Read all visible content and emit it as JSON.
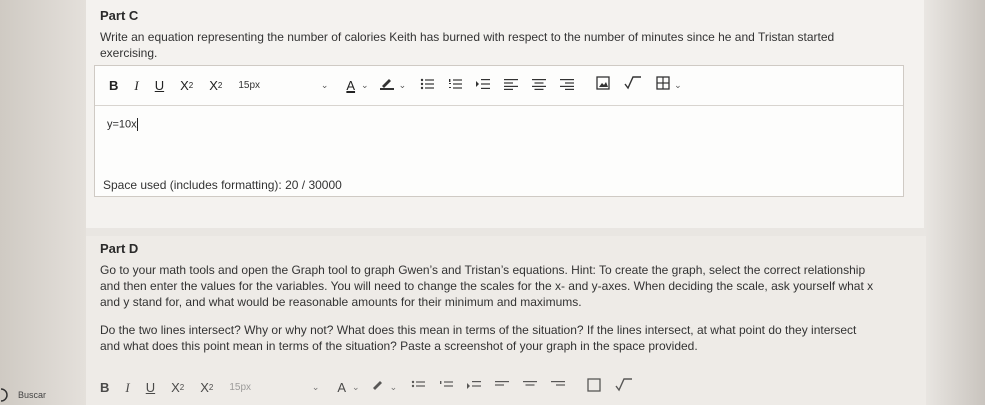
{
  "partC": {
    "title": "Part C",
    "prompt_line1": "Write an equation representing the number of calories Keith has burned with respect to the number of minutes since he and Tristan started",
    "prompt_line2": "exercising.",
    "editor": {
      "toolbar": {
        "bold": "B",
        "italic": "I",
        "underline": "U",
        "superscript_base": "X",
        "superscript_mark": "2",
        "subscript_base": "X",
        "subscript_mark": "2",
        "font_size": "15px",
        "font_color_label": "A"
      },
      "content": "y=10x",
      "space_used": "Space used (includes formatting): 20 / 30000"
    }
  },
  "partD": {
    "title": "Part D",
    "para1_line1": "Go to your math tools and open the Graph tool to graph Gwen’s and Tristan’s equations. Hint: To create the graph, select the correct relationship",
    "para1_line2": "and then enter the values for the variables. You will need to change the scales for the x- and y-axes. When deciding the scale, ask yourself what x",
    "para1_line3": "and y stand for, and what would be reasonable amounts for their minimum and maximums.",
    "para2_line1": "Do the two lines intersect? Why or why not? What does this mean in terms of the situation? If the lines intersect, at what point do they intersect",
    "para2_line2": "and what does this point mean in terms of the situation? Paste a screenshot of your graph in the space provided.",
    "editor": {
      "toolbar": {
        "bold": "B",
        "italic": "I",
        "underline": "U",
        "superscript_base": "X",
        "superscript_mark": "2",
        "subscript_base": "X",
        "subscript_mark": "2",
        "font_size": "15px",
        "font_color_label": "A"
      }
    }
  },
  "taskbar": {
    "search_label": "Buscar"
  },
  "colors": {
    "panel": "#f4f2ef",
    "background": "#e9e6e2",
    "editor_border": "#cfcac4",
    "text": "#2a2a2a"
  }
}
